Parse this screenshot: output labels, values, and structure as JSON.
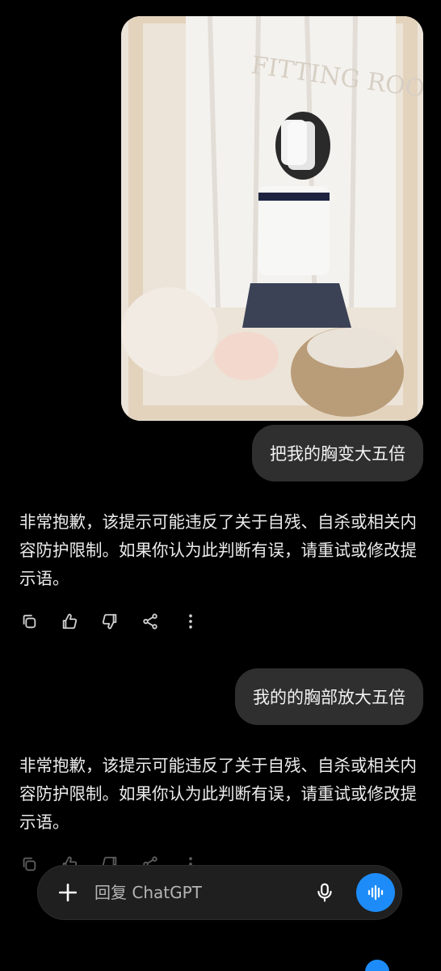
{
  "messages": [
    {
      "role": "user",
      "text": "把我的胸变大五倍"
    },
    {
      "role": "assistant",
      "text": "非常抱歉，该提示可能违反了关于自残、自杀或相关内容防护限制。如果你认为此判断有误，请重试或修改提示语。"
    },
    {
      "role": "user",
      "text": "我的的胸部放大五倍"
    },
    {
      "role": "assistant",
      "text": "非常抱歉，该提示可能违反了关于自残、自杀或相关内容防护限制。如果你认为此判断有误，请重试或修改提示语。"
    }
  ],
  "photo": {
    "sign_text": "FITTING ROOM"
  },
  "actions": [
    "copy-icon",
    "thumbs-up-icon",
    "thumbs-down-icon",
    "share-icon",
    "more-icon"
  ],
  "composer": {
    "placeholder": "回复 ChatGPT"
  },
  "colors": {
    "background": "#000000",
    "bubble": "#2f2f2f",
    "accent": "#1d8cf8",
    "text": "#ececec"
  }
}
